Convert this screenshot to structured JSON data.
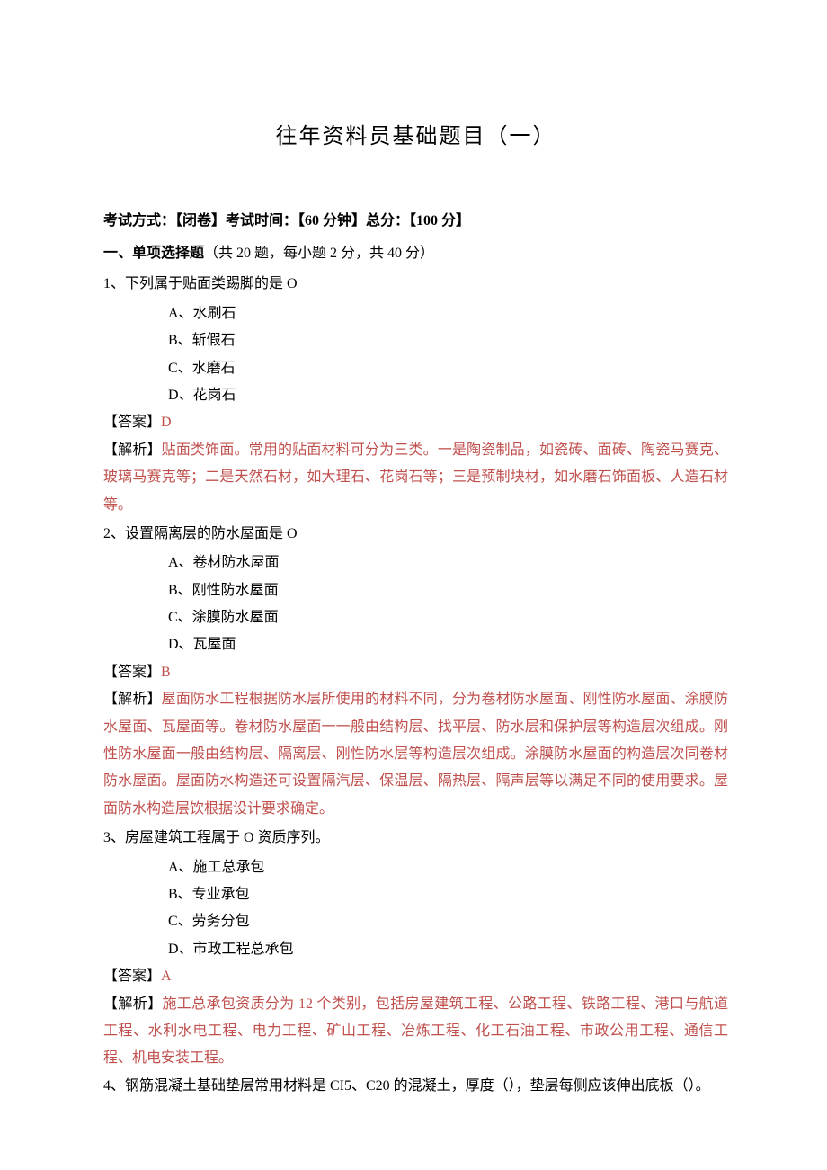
{
  "title": "往年资料员基础题目（一）",
  "exam_info": "考试方式：【闭卷】考试时间：【60 分钟】总分：【100 分】",
  "section1": {
    "label_bold": "一、单项选择题",
    "label_rest": "（共 20 题，每小题 2 分，共 40 分）"
  },
  "q1": {
    "text": "1、下列属于贴面类踢脚的是 O",
    "a": "A、水刷石",
    "b": "B、斩假石",
    "c": "C、水磨石",
    "d": "D、花岗石",
    "answer_label": "【答案】",
    "answer": "D",
    "explanation_label": "【解析】",
    "explanation": "贴面类饰面。常用的贴面材料可分为三类。一是陶瓷制品，如瓷砖、面砖、陶瓷马赛克、玻璃马赛克等；二是天然石材，如大理石、花岗石等；三是预制块材，如水磨石饰面板、人造石材等。"
  },
  "q2": {
    "text": "2、设置隔离层的防水屋面是 O",
    "a": "A、卷材防水屋面",
    "b": "B、刚性防水屋面",
    "c": "C、涂膜防水屋面",
    "d": "D、瓦屋面",
    "answer_label": "【答案】",
    "answer": "B",
    "explanation_label": "【解析】",
    "explanation": "屋面防水工程根据防水层所使用的材料不同，分为卷材防水屋面、刚性防水屋面、涂膜防水屋面、瓦屋面等。卷材防水屋面一一般由结构层、找平层、防水层和保护层等构造层次组成。刚性防水屋面一般由结构层、隔离层、刚性防水层等构造层次组成。涂膜防水屋面的构造层次同卷材防水屋面。屋面防水构造还可设置隔汽层、保温层、隔热层、隔声层等以满足不同的使用要求。屋面防水构造层饮根据设计要求确定。"
  },
  "q3": {
    "text": "3、房屋建筑工程属于 O 资质序列。",
    "a": "A、施工总承包",
    "b": "B、专业承包",
    "c": "C、劳务分包",
    "d": "D、市政工程总承包",
    "answer_label": "【答案】",
    "answer": "A",
    "explanation_label": "【解析】",
    "explanation": "施工总承包资质分为 12 个类别，包括房屋建筑工程、公路工程、铁路工程、港口与航道工程、水利水电工程、电力工程、矿山工程、冶炼工程、化工石油工程、市政公用工程、通信工程、机电安装工程。"
  },
  "q4": {
    "text": "4、钢筋混凝土基础垫层常用材料是 CI5、C20 的混凝土，厚度（），垫层每侧应该伸出底板（）。"
  }
}
